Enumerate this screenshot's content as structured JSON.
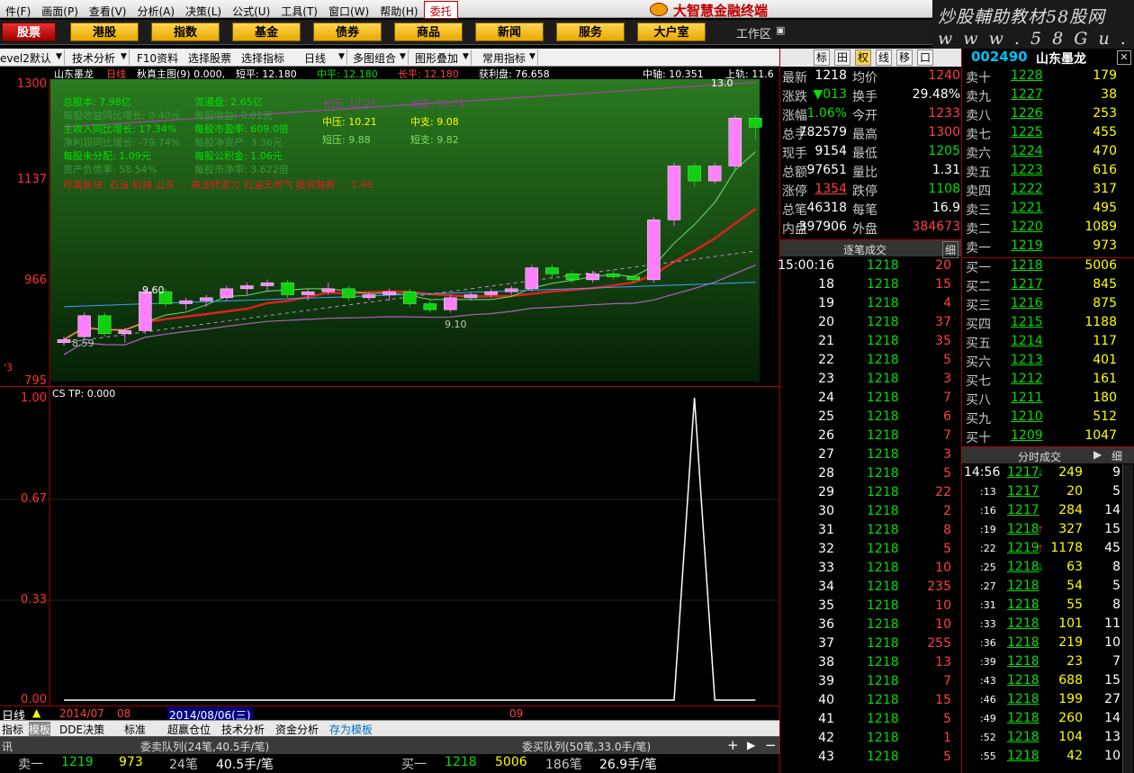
{
  "menu": [
    "件(F)",
    "画面(P)",
    "查看(V)",
    "分析(A)",
    "决策(L)",
    "公式(U)",
    "工具(T)",
    "窗口(W)",
    "帮助(H)"
  ],
  "menu_wt": "委托",
  "brand": "大智慧金融终端",
  "watermark": {
    "line1": "炒股輔助教材58股网",
    "line2": "w w w . 5 8 G u . c o m"
  },
  "nav": [
    "股票",
    "港股",
    "指数",
    "基金",
    "债券",
    "商品",
    "新闻",
    "服务",
    "大户室"
  ],
  "workarea": "工作区",
  "toolbar": [
    "evel2默认",
    "技术分析",
    "F10资料",
    "选择股票",
    "选择指标",
    "日线",
    "多图组合",
    "图形叠加",
    "常用指标"
  ],
  "infobar": {
    "name": "山东墨龙",
    "period": "日线",
    "main": "秋真主图(9) 0.000,",
    "d1": "短平: 12.180",
    "d2": "中平: 12.180",
    "d3": "长平: 12.180",
    "d4": "获利盘: 76.658",
    "d5": "中轴: 10.351",
    "d6": "上轨: 11.6"
  },
  "kchart": {
    "ticks": [
      "1300",
      "1137",
      "966",
      "795"
    ],
    "fund_left": [
      "总股本: 7.98亿",
      "每股收益同比增长: 0.40元",
      "主收入同比增长: 17.34%",
      "净利润同比增长: -79.74%",
      "每股未分配: 1.09元",
      "资产负债率: 58.54%"
    ],
    "fund_mid": [
      "流通盘: 2.65亿",
      "每股收益: 0.01元",
      "每股市盈率: 609.0倍",
      "每股净资产: 3.36元",
      "每股公积金: 1.06元",
      "每股市净率: 3.622倍"
    ],
    "levels": [
      "长压: 12.21",
      "中压: 10.21",
      "短压: 9.88"
    ],
    "supports": [
      "长支: 10.79",
      "中支: 9.08",
      "短支: 9.82"
    ],
    "redline": "所属板块: 石油  机械  山东  ...    高送转潜力  石油天然气  融资融券  ...  1.60",
    "label_hi": "13.0",
    "label_960": "9.60",
    "label_859": "8.59",
    "label_910": "9.10"
  },
  "chart_data": [
    {
      "type": "candlestick",
      "title": "山东墨龙 日线",
      "ylim": [
        7.95,
        13.0
      ],
      "ohlc": [
        [
          8.6,
          8.7,
          8.55,
          8.65
        ],
        [
          8.7,
          9.1,
          8.65,
          9.05
        ],
        [
          9.05,
          9.1,
          8.7,
          8.75
        ],
        [
          8.75,
          8.85,
          8.6,
          8.8
        ],
        [
          8.8,
          9.5,
          8.75,
          9.45
        ],
        [
          9.45,
          9.5,
          9.2,
          9.25
        ],
        [
          9.25,
          9.35,
          9.15,
          9.3
        ],
        [
          9.3,
          9.4,
          9.2,
          9.35
        ],
        [
          9.35,
          9.55,
          9.3,
          9.5
        ],
        [
          9.5,
          9.6,
          9.4,
          9.55
        ],
        [
          9.55,
          9.65,
          9.45,
          9.6
        ],
        [
          9.6,
          9.65,
          9.35,
          9.4
        ],
        [
          9.4,
          9.5,
          9.3,
          9.45
        ],
        [
          9.45,
          9.6,
          9.4,
          9.5
        ],
        [
          9.5,
          9.55,
          9.3,
          9.35
        ],
        [
          9.35,
          9.45,
          9.3,
          9.4
        ],
        [
          9.4,
          9.5,
          9.3,
          9.45
        ],
        [
          9.45,
          9.5,
          9.2,
          9.25
        ],
        [
          9.25,
          9.3,
          9.1,
          9.15
        ],
        [
          9.15,
          9.4,
          9.1,
          9.35
        ],
        [
          9.35,
          9.45,
          9.3,
          9.4
        ],
        [
          9.4,
          9.5,
          9.35,
          9.45
        ],
        [
          9.45,
          9.55,
          9.4,
          9.5
        ],
        [
          9.5,
          9.9,
          9.45,
          9.85
        ],
        [
          9.85,
          9.9,
          9.7,
          9.75
        ],
        [
          9.75,
          9.8,
          9.6,
          9.65
        ],
        [
          9.65,
          9.8,
          9.6,
          9.75
        ],
        [
          9.75,
          9.8,
          9.65,
          9.7
        ],
        [
          9.7,
          9.75,
          9.6,
          9.65
        ],
        [
          9.65,
          10.7,
          9.6,
          10.65
        ],
        [
          10.65,
          11.6,
          10.55,
          11.55
        ],
        [
          11.55,
          11.6,
          11.2,
          11.3
        ],
        [
          11.3,
          11.6,
          11.25,
          11.55
        ],
        [
          11.55,
          12.4,
          11.5,
          12.35
        ],
        [
          12.35,
          12.4,
          12.0,
          12.2
        ]
      ]
    },
    {
      "type": "line",
      "title": "CS TP: 0.000",
      "ylim": [
        0,
        1
      ],
      "yticks": [
        "1.00",
        "0.67",
        "0.33",
        "0.00"
      ],
      "values": [
        0,
        0,
        0,
        0,
        0,
        0,
        0,
        0,
        0,
        0,
        0,
        0,
        0,
        0,
        0,
        0,
        0,
        0,
        0,
        0,
        0,
        0,
        0,
        0,
        0,
        0,
        0,
        0,
        0,
        0,
        0,
        1,
        0,
        0,
        0,
        0
      ]
    }
  ],
  "sub": {
    "title": "CS TP: 0.000"
  },
  "dates": {
    "d1": "2014/07",
    "d2": "08",
    "d3": "2014/08/06(三)",
    "d4": "09"
  },
  "bottomtabs": [
    "指标",
    "模板",
    "DDE决策",
    "标准",
    "超赢仓位",
    "技术分析",
    "资金分析",
    "存为模板"
  ],
  "status": {
    "tag": "日线"
  },
  "queue": {
    "sell_hdr": "委卖队列(24笔,40.5手/笔)",
    "buy_hdr": "委买队列(50笔,33.0手/笔)",
    "side": "讯",
    "sell_row": [
      "卖一",
      "1219",
      "973",
      "24笔",
      "40.5手/笔"
    ],
    "buy_row": [
      "买一",
      "1218",
      "5006",
      "186笔",
      "26.9手/笔"
    ]
  },
  "right": {
    "buttons": [
      "标",
      "田",
      "权",
      "线",
      "移",
      "口"
    ],
    "code": "002490",
    "name": "山东墨龙",
    "stats": [
      [
        "最新",
        "1218",
        "均价",
        "1240"
      ],
      [
        "涨跌",
        "▼013",
        "换手",
        "29.48%"
      ],
      [
        "涨幅",
        "-1.06%",
        "今开",
        "1233"
      ],
      [
        "总手",
        "782579",
        "最高",
        "1300"
      ],
      [
        "现手",
        "9154",
        "最低",
        "1205"
      ],
      [
        "总额",
        "97651",
        "量比",
        "1.31"
      ],
      [
        "涨停",
        "1354",
        "跌停",
        "1108"
      ],
      [
        "总笔",
        "46318",
        "每笔",
        "16.9"
      ],
      [
        "内盘",
        "397906",
        "外盘",
        "384673"
      ]
    ],
    "zbhdr": "逐笔成交",
    "zbbtn": "细",
    "zb": [
      [
        "15:00:16",
        "1218",
        "20"
      ],
      [
        "18",
        "1218",
        "15"
      ],
      [
        "19",
        "1218",
        "4"
      ],
      [
        "20",
        "1218",
        "37"
      ],
      [
        "21",
        "1218",
        "35"
      ],
      [
        "22",
        "1218",
        "5"
      ],
      [
        "23",
        "1218",
        "3"
      ],
      [
        "24",
        "1218",
        "7"
      ],
      [
        "25",
        "1218",
        "6"
      ],
      [
        "26",
        "1218",
        "7"
      ],
      [
        "27",
        "1218",
        "3"
      ],
      [
        "28",
        "1218",
        "5"
      ],
      [
        "29",
        "1218",
        "22"
      ],
      [
        "30",
        "1218",
        "2"
      ],
      [
        "31",
        "1218",
        "8"
      ],
      [
        "32",
        "1218",
        "5"
      ],
      [
        "33",
        "1218",
        "10"
      ],
      [
        "34",
        "1218",
        "235"
      ],
      [
        "35",
        "1218",
        "10"
      ],
      [
        "36",
        "1218",
        "10"
      ],
      [
        "37",
        "1218",
        "255"
      ],
      [
        "38",
        "1218",
        "13"
      ],
      [
        "39",
        "1218",
        "7"
      ],
      [
        "40",
        "1218",
        "15"
      ],
      [
        "41",
        "1218",
        "5"
      ],
      [
        "42",
        "1218",
        "1"
      ],
      [
        "43",
        "1218",
        "5"
      ]
    ],
    "sells": [
      [
        "卖十",
        "1228",
        "179"
      ],
      [
        "卖九",
        "1227",
        "38"
      ],
      [
        "卖八",
        "1226",
        "253"
      ],
      [
        "卖七",
        "1225",
        "455"
      ],
      [
        "卖六",
        "1224",
        "470"
      ],
      [
        "卖五",
        "1223",
        "616"
      ],
      [
        "卖四",
        "1222",
        "317"
      ],
      [
        "卖三",
        "1221",
        "495"
      ],
      [
        "卖二",
        "1220",
        "1089"
      ],
      [
        "卖一",
        "1219",
        "973"
      ]
    ],
    "buys": [
      [
        "买一",
        "1218",
        "5006"
      ],
      [
        "买二",
        "1217",
        "845"
      ],
      [
        "买三",
        "1216",
        "875"
      ],
      [
        "买四",
        "1215",
        "1188"
      ],
      [
        "买五",
        "1214",
        "117"
      ],
      [
        "买六",
        "1213",
        "401"
      ],
      [
        "买七",
        "1212",
        "161"
      ],
      [
        "买八",
        "1211",
        "180"
      ],
      [
        "买九",
        "1210",
        "512"
      ],
      [
        "买十",
        "1209",
        "1047"
      ]
    ],
    "fshdr": "分时成交",
    "fsbtn": "细",
    "fs": [
      [
        "14:56",
        "1217",
        "249",
        "9",
        "down"
      ],
      [
        ":13",
        "1217",
        "20",
        "5",
        ""
      ],
      [
        ":16",
        "1217",
        "284",
        "14",
        ""
      ],
      [
        ":19",
        "1218",
        "327",
        "15",
        "up"
      ],
      [
        ":22",
        "1219",
        "1178",
        "45",
        "up"
      ],
      [
        ":25",
        "1218",
        "63",
        "8",
        "down"
      ],
      [
        ":27",
        "1218",
        "54",
        "5",
        ""
      ],
      [
        ":31",
        "1218",
        "55",
        "8",
        ""
      ],
      [
        ":33",
        "1218",
        "101",
        "11",
        ""
      ],
      [
        ":36",
        "1218",
        "219",
        "10",
        ""
      ],
      [
        ":39",
        "1218",
        "23",
        "7",
        ""
      ],
      [
        ":43",
        "1218",
        "688",
        "15",
        ""
      ],
      [
        ":46",
        "1218",
        "199",
        "27",
        ""
      ],
      [
        ":49",
        "1218",
        "260",
        "14",
        ""
      ],
      [
        ":52",
        "1218",
        "104",
        "13",
        ""
      ],
      [
        ":55",
        "1218",
        "42",
        "10",
        ""
      ]
    ]
  }
}
